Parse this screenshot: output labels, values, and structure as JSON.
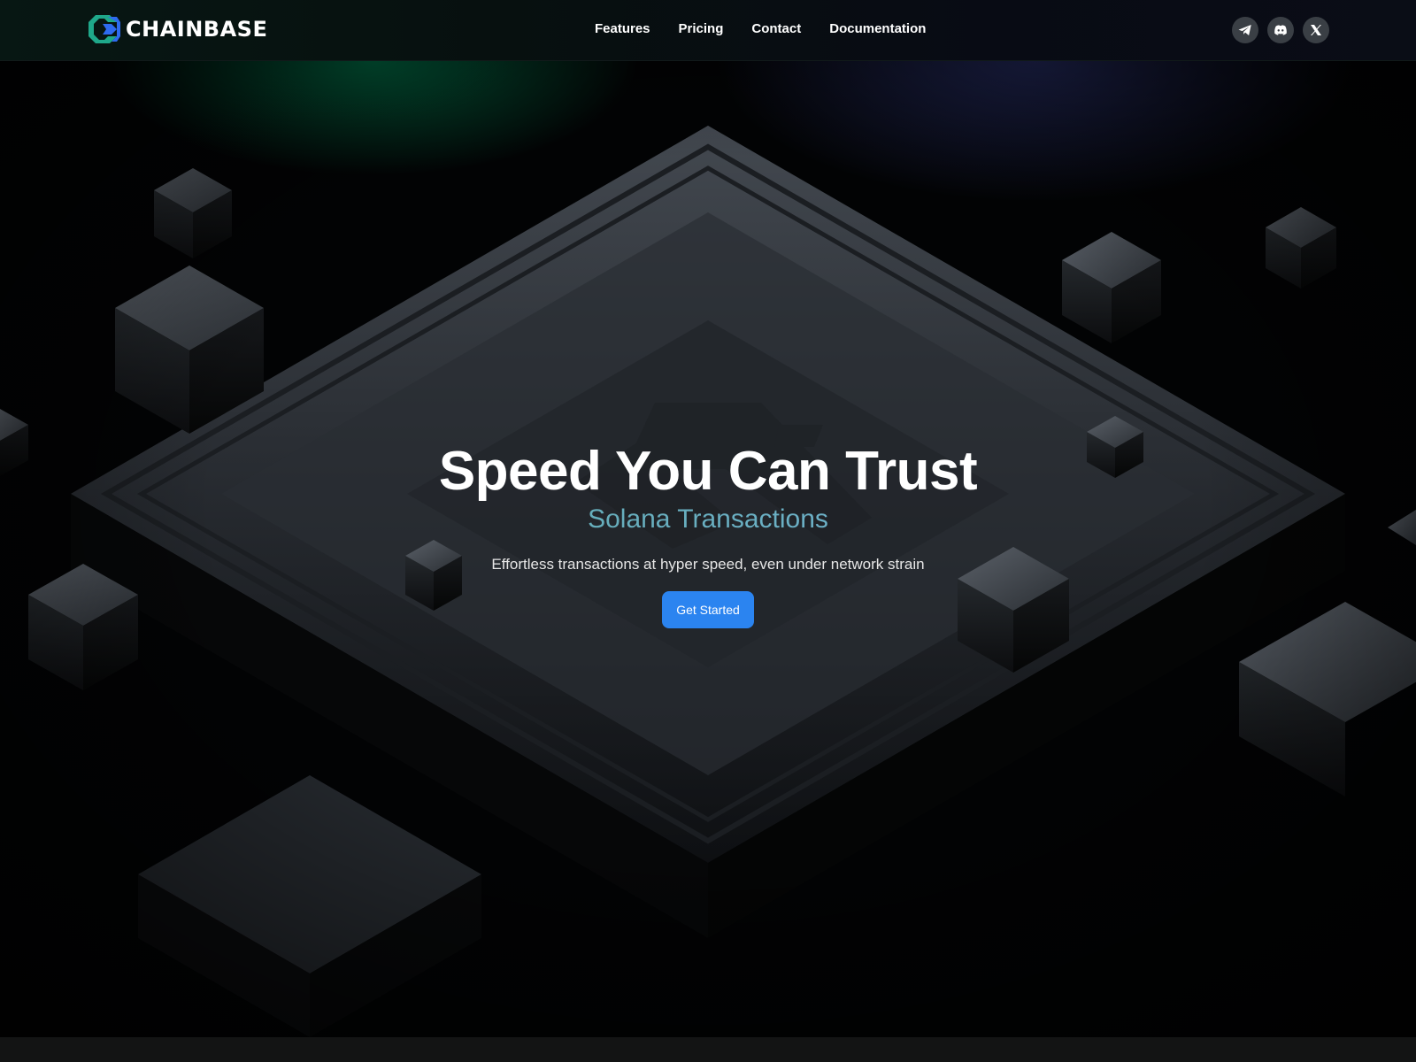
{
  "header": {
    "brand": "CHAINBASE",
    "nav": [
      {
        "label": "Features"
      },
      {
        "label": "Pricing"
      },
      {
        "label": "Contact"
      },
      {
        "label": "Documentation"
      }
    ],
    "social": [
      {
        "icon": "telegram-icon"
      },
      {
        "icon": "discord-icon"
      },
      {
        "icon": "x-icon"
      }
    ]
  },
  "hero": {
    "title": "Speed You Can Trust",
    "subtitle": "Solana Transactions",
    "description": "Effortless transactions at hyper speed, even under network strain",
    "cta_label": "Get Started"
  },
  "colors": {
    "accent_blue": "#2b84f0",
    "subtitle_gradient_start": "#58a8a0",
    "subtitle_gradient_end": "#7ab6e2",
    "logo_green": "#1fa88a",
    "logo_blue": "#2e6bf0"
  }
}
